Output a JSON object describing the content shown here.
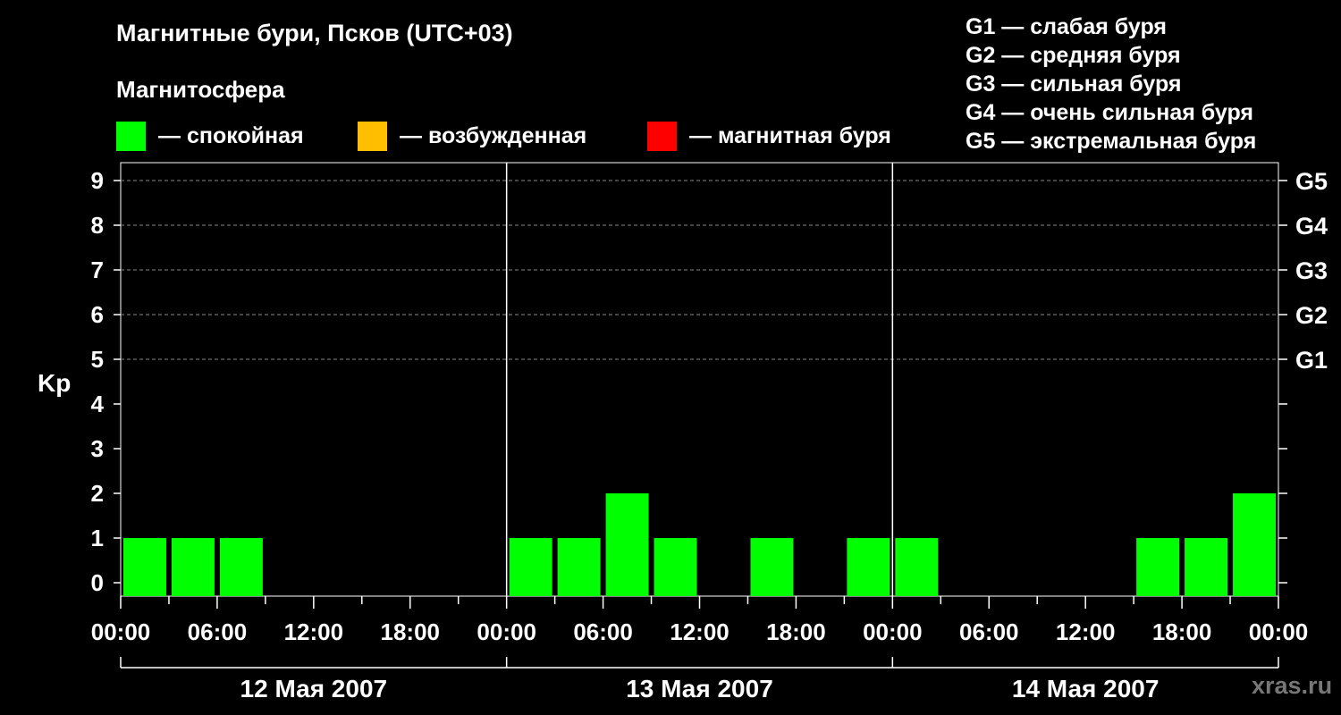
{
  "header": {
    "title": "Магнитные бури, Псков (UTC+03)",
    "subtitle": "Магнитосфера",
    "legend": [
      {
        "label": "— спокойная",
        "color": "#00ff00"
      },
      {
        "label": "— возбужденная",
        "color": "#ffbf00"
      },
      {
        "label": "— магнитная буря",
        "color": "#ff0000"
      }
    ],
    "storm_scale": [
      "G1 — слабая буря",
      "G2 — средняя буря",
      "G3 — сильная буря",
      "G4 — очень сильная буря",
      "G5 — экстремальная буря"
    ],
    "watermark": "xras.ru"
  },
  "chart_data": {
    "type": "bar",
    "ylabel": "Kp",
    "ylim": [
      0,
      9
    ],
    "yticks": [
      "0",
      "1",
      "2",
      "3",
      "4",
      "5",
      "6",
      "7",
      "8",
      "9"
    ],
    "right_ticks": [
      {
        "value": 5,
        "label": "G1"
      },
      {
        "value": 6,
        "label": "G2"
      },
      {
        "value": 7,
        "label": "G3"
      },
      {
        "value": 8,
        "label": "G4"
      },
      {
        "value": 9,
        "label": "G5"
      }
    ],
    "grid": "dashed at Kp 5-9",
    "xtick_labels": [
      "00:00",
      "06:00",
      "12:00",
      "18:00",
      "00:00",
      "06:00",
      "12:00",
      "18:00",
      "00:00",
      "06:00",
      "12:00",
      "18:00",
      "00:00"
    ],
    "days": [
      "12 Мая 2007",
      "13 Мая 2007",
      "14 Мая 2007"
    ],
    "interval_hours": 3,
    "color": "#00ff00",
    "values": [
      1,
      1,
      1,
      0,
      0,
      0,
      0,
      0,
      1,
      1,
      2,
      1,
      0,
      1,
      0,
      1,
      1,
      0,
      0,
      0,
      0,
      1,
      1,
      2
    ]
  }
}
